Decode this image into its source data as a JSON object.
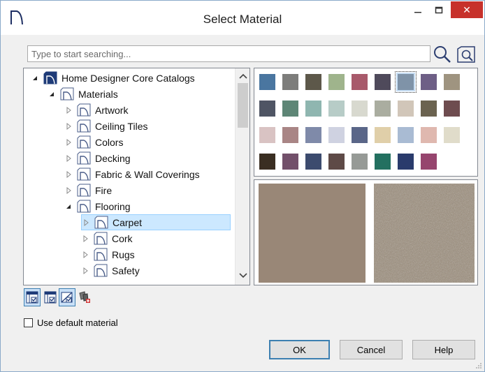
{
  "window": {
    "title": "Select Material",
    "close_glyph": "✕"
  },
  "search": {
    "placeholder": "Type to start searching...",
    "value": ""
  },
  "tree": {
    "items": [
      {
        "label": "Home Designer Core Catalogs",
        "level": 0,
        "expanded": true,
        "icon": "catalog-folder-icon"
      },
      {
        "label": "Materials",
        "level": 1,
        "expanded": true,
        "icon": "folder-icon"
      },
      {
        "label": "Artwork",
        "level": 2,
        "expanded": false,
        "icon": "folder-icon"
      },
      {
        "label": "Ceiling Tiles",
        "level": 2,
        "expanded": false,
        "icon": "folder-icon"
      },
      {
        "label": "Colors",
        "level": 2,
        "expanded": false,
        "icon": "folder-icon"
      },
      {
        "label": "Decking",
        "level": 2,
        "expanded": false,
        "icon": "folder-icon"
      },
      {
        "label": "Fabric & Wall Coverings",
        "level": 2,
        "expanded": false,
        "icon": "folder-icon"
      },
      {
        "label": "Fire",
        "level": 2,
        "expanded": false,
        "icon": "folder-icon"
      },
      {
        "label": "Flooring",
        "level": 2,
        "expanded": true,
        "icon": "folder-icon"
      },
      {
        "label": "Carpet",
        "level": 3,
        "expanded": false,
        "selected": true,
        "icon": "folder-icon"
      },
      {
        "label": "Cork",
        "level": 3,
        "expanded": false,
        "icon": "folder-icon"
      },
      {
        "label": "Rugs",
        "level": 3,
        "expanded": false,
        "icon": "folder-icon"
      },
      {
        "label": "Safety",
        "level": 3,
        "expanded": false,
        "icon": "folder-icon"
      }
    ]
  },
  "swatches": {
    "selected_index": 6,
    "colors": [
      "#4a76a0",
      "#7d7d7b",
      "#5d584a",
      "#9fb48c",
      "#a85a6b",
      "#4f4a5b",
      "#7f93a8",
      "#6e5f86",
      "#9f9480",
      "#4f5564",
      "#5e8676",
      "#8fb6b0",
      "#b7ccc7",
      "#d8d9cf",
      "#aaada0",
      "#d1c6b9",
      "#6b6350",
      "#6e4c4f",
      "#d9c3c3",
      "#a98585",
      "#7f8aa9",
      "#cfd2e1",
      "#5a6688",
      "#e0cfa9",
      "#a9bbd3",
      "#dfb8af",
      "#e0dcca",
      "#3a2e22",
      "#72506a",
      "#3c4b6e",
      "#5e4a47",
      "#969a96",
      "#237060",
      "#2a3b6c",
      "#96456e"
    ]
  },
  "preview": {
    "base_color": "#998777"
  },
  "toolbar": {
    "icons": [
      "tree-toggle-icon",
      "list-toggle-icon",
      "material-toggle-icon",
      "eyedropper-icon"
    ]
  },
  "options": {
    "use_default_label": "Use default material",
    "use_default_checked": false
  },
  "buttons": {
    "ok_label": "OK",
    "cancel_label": "Cancel",
    "help_label": "Help"
  },
  "colors": {
    "selection_fill": "#cce8ff",
    "selection_border": "#99d1ff",
    "close_red": "#c7312b",
    "accent_blue": "#3c7fb1"
  }
}
